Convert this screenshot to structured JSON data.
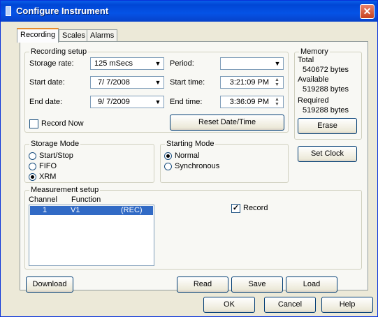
{
  "window": {
    "title": "Configure Instrument",
    "close_glyph": "✕"
  },
  "tabs": [
    {
      "label": "Recording",
      "active": true
    },
    {
      "label": "Scales",
      "active": false
    },
    {
      "label": "Alarms",
      "active": false
    }
  ],
  "recording_setup": {
    "legend": "Recording setup",
    "storage_rate_label": "Storage rate:",
    "storage_rate_value": "125 mSecs",
    "period_label": "Period:",
    "period_value": "",
    "start_date_label": "Start date:",
    "start_date_value": "7/ 7/2008",
    "start_time_label": "Start time:",
    "start_time_value": "3:21:09 PM",
    "end_date_label": "End date:",
    "end_date_value": "9/ 7/2009",
    "end_time_label": "End time:",
    "end_time_value": "3:36:09 PM",
    "record_now_label": "Record Now",
    "record_now_checked": false,
    "reset_button": "Reset Date/Time"
  },
  "memory": {
    "legend": "Memory",
    "total_label": "Total",
    "total_value": "540672 bytes",
    "available_label": "Available",
    "available_value": "519288 bytes",
    "required_label": "Required",
    "required_value": "519288 bytes",
    "erase_button": "Erase"
  },
  "storage_mode": {
    "legend": "Storage Mode",
    "options": [
      {
        "label": "Start/Stop",
        "selected": false
      },
      {
        "label": "FIFO",
        "selected": false
      },
      {
        "label": "XRM",
        "selected": true
      }
    ]
  },
  "starting_mode": {
    "legend": "Starting Mode",
    "options": [
      {
        "label": "Normal",
        "selected": true
      },
      {
        "label": "Synchronous",
        "selected": false
      }
    ]
  },
  "set_clock_button": "Set Clock",
  "measurement_setup": {
    "legend": "Measurement setup",
    "col_channel": "Channel",
    "col_function": "Function",
    "rows": [
      {
        "channel": "1",
        "function": "V1",
        "mode": "(REC)"
      }
    ],
    "record_label": "Record",
    "record_checked": true
  },
  "panel_buttons": {
    "download": "Download",
    "read": "Read",
    "save": "Save",
    "load": "Load"
  },
  "dialog_buttons": {
    "ok": "OK",
    "cancel": "Cancel",
    "help": "Help"
  },
  "glyphs": {
    "combo_arrow": "▼",
    "spin_up": "▲",
    "spin_down": "▼",
    "check": "✓"
  }
}
